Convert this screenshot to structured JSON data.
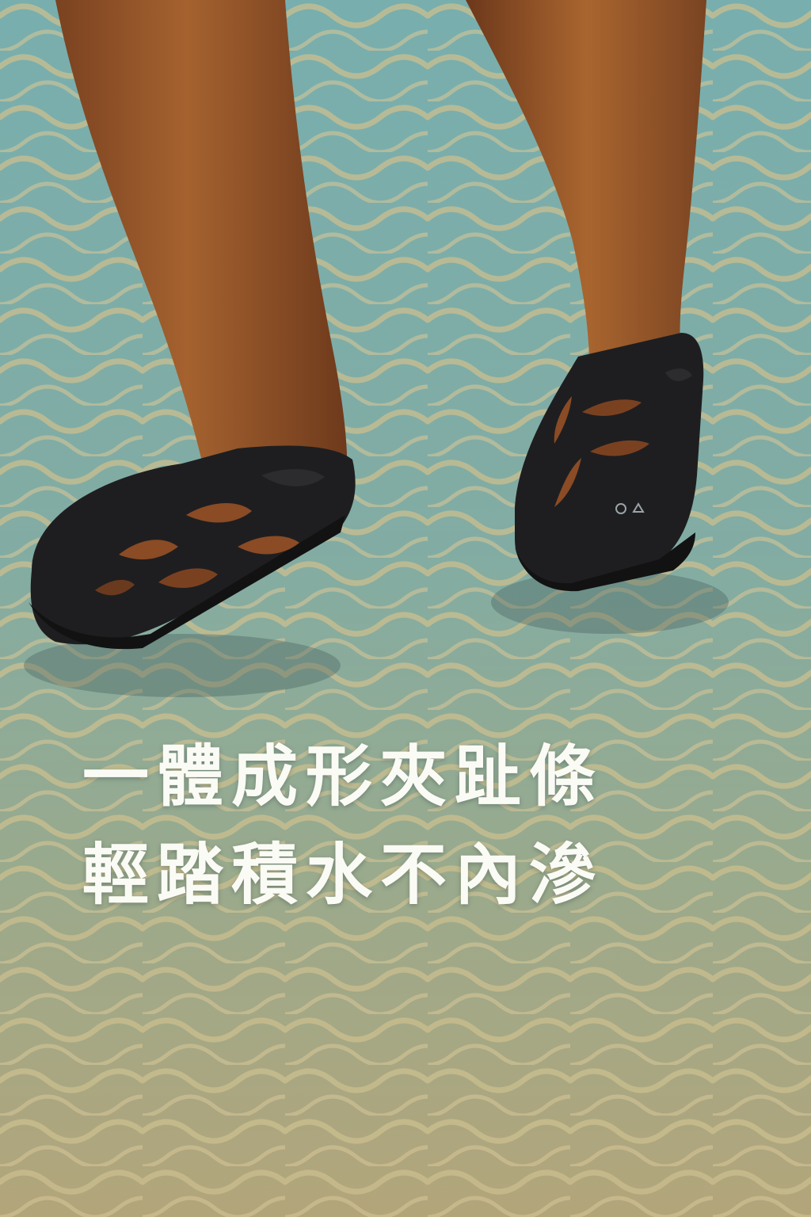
{
  "headline": {
    "line1": "一體成形夾趾條",
    "line2": "輕踏積水不內滲"
  },
  "colors": {
    "water_top": "#7fb0ad",
    "water_bottom": "#b1a67c",
    "ripple": "#c9bf90",
    "skin": "#9c5a2c",
    "shoe": "#1f1f20",
    "text": "#fbfbf6"
  }
}
